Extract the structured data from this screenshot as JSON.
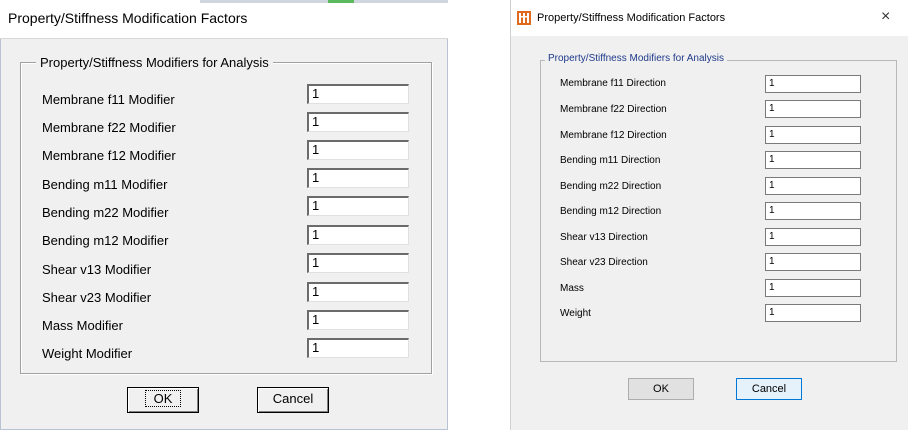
{
  "left_dialog": {
    "title": "Property/Stiffness Modification Factors",
    "group_label": "Property/Stiffness Modifiers for Analysis",
    "fields": [
      {
        "label": "Membrane f11 Modifier",
        "value": "1"
      },
      {
        "label": "Membrane f22 Modifier",
        "value": "1"
      },
      {
        "label": "Membrane f12 Modifier",
        "value": "1"
      },
      {
        "label": "Bending  m11 Modifier",
        "value": "1"
      },
      {
        "label": "Bending  m22 Modifier",
        "value": "1"
      },
      {
        "label": "Bending  m12 Modifier",
        "value": "1"
      },
      {
        "label": "Shear  v13 Modifier",
        "value": "1"
      },
      {
        "label": "Shear  v23 Modifier",
        "value": "1"
      },
      {
        "label": "Mass Modifier",
        "value": "1"
      },
      {
        "label": "Weight Modifier",
        "value": "1"
      }
    ],
    "ok_label": "OK",
    "cancel_label": "Cancel"
  },
  "right_dialog": {
    "title": "Property/Stiffness Modification Factors",
    "close_glyph": "×",
    "group_label": "Property/Stiffness Modifiers for Analysis",
    "fields": [
      {
        "label": "Membrane f11 Direction",
        "value": "1"
      },
      {
        "label": "Membrane f22 Direction",
        "value": "1"
      },
      {
        "label": "Membrane f12 Direction",
        "value": "1"
      },
      {
        "label": "Bending m11 Direction",
        "value": "1"
      },
      {
        "label": "Bending m22 Direction",
        "value": "1"
      },
      {
        "label": "Bending m12 Direction",
        "value": "1"
      },
      {
        "label": "Shear v13 Direction",
        "value": "1"
      },
      {
        "label": "Shear v23 Direction",
        "value": "1"
      },
      {
        "label": "Mass",
        "value": "1"
      },
      {
        "label": "Weight",
        "value": "1"
      }
    ],
    "ok_label": "OK",
    "cancel_label": "Cancel"
  },
  "colors": {
    "dialog_bg": "#f0f0f0",
    "group_label_blue": "#1f3a8a",
    "focus_button_border": "#0078d7",
    "app_icon_orange": "#e06a1b"
  },
  "icons": {
    "app_icon": "app-icon",
    "close": "close-icon"
  }
}
